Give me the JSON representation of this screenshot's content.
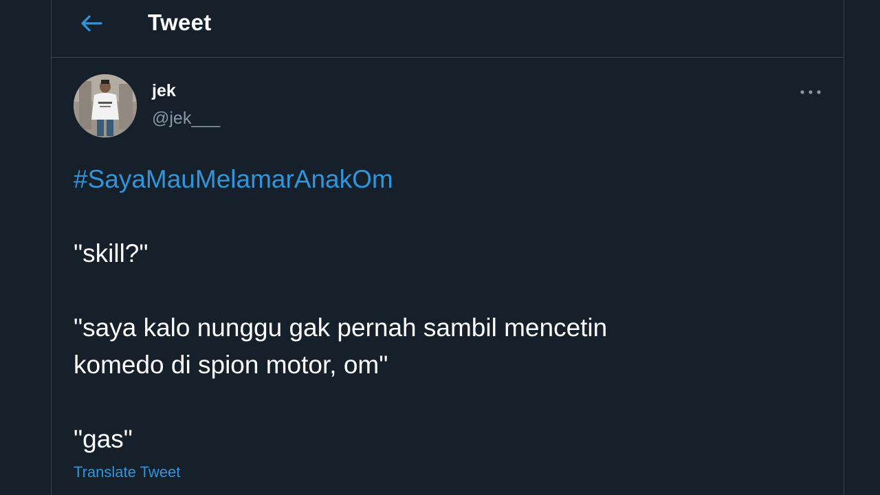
{
  "header": {
    "title": "Tweet",
    "back_icon": "arrow-left-icon"
  },
  "tweet": {
    "author": {
      "name": "jek",
      "handle": "@jek___"
    },
    "hashtag": "#SayaMauMelamarAnakOm",
    "lines": [
      "\"skill?\"",
      "\"saya kalo nunggu gak pernah sambil mencetin",
      "komedo di spion motor, om\"",
      "\"gas\""
    ],
    "translate_label": "Translate Tweet",
    "more_icon": "more-horizontal-icon"
  },
  "colors": {
    "background": "#15202b",
    "border": "#38444d",
    "accent": "#2f95dc",
    "text": "#ffffff",
    "secondary_text": "#8899a6"
  }
}
